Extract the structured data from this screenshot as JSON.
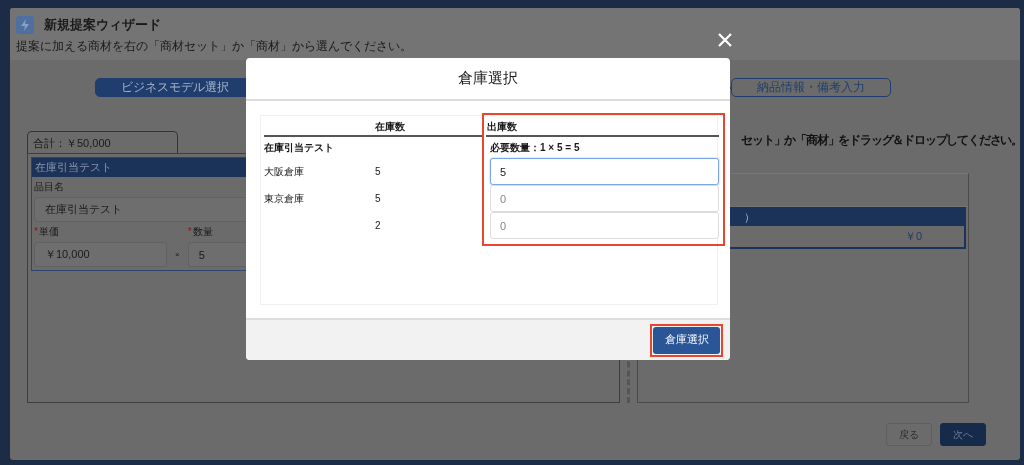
{
  "wizard": {
    "title": "新規提案ウィザード",
    "subtitle": "提案に加える商材を右の「商材セット」か「商材」から選んでください。"
  },
  "steps": [
    {
      "label": "ビジネスモデル選択",
      "done": true
    },
    {
      "label": "納品情報・備考入力",
      "done": false
    }
  ],
  "left_panel": {
    "tab": "合計：￥50,000",
    "item": {
      "title": "在庫引当テスト",
      "name_label": "品目名",
      "name_value": "在庫引当テスト",
      "price_label": "単価",
      "price_value": "￥10,000",
      "times": "×",
      "qty_label": "数量",
      "qty_value": "5",
      "required_mark": "*"
    }
  },
  "right_panel": {
    "instruction": "セット」か「商材」をドラッグ＆ドロップしてください。",
    "item": {
      "title": "）",
      "amount": "￥0"
    }
  },
  "buttons": [
    {
      "label": "戻る",
      "kind": "secondary"
    },
    {
      "label": "次へ",
      "kind": "primary"
    }
  ],
  "modal": {
    "title": "倉庫選択",
    "columns": [
      "在庫数",
      "出庫数"
    ],
    "product": "在庫引当テスト",
    "required_quantity": "必要数量：1 × 5 = 5",
    "highlight_column": true,
    "rows": [
      {
        "warehouse": "大阪倉庫",
        "stock": "5",
        "value": "5",
        "focused": true
      },
      {
        "warehouse": "東京倉庫",
        "stock": "5",
        "placeholder": "0",
        "focused": false
      },
      {
        "stock": "2",
        "placeholder": "0",
        "focused": false
      }
    ],
    "confirm": {
      "label": "倉庫選択",
      "highlighted": true
    }
  }
}
